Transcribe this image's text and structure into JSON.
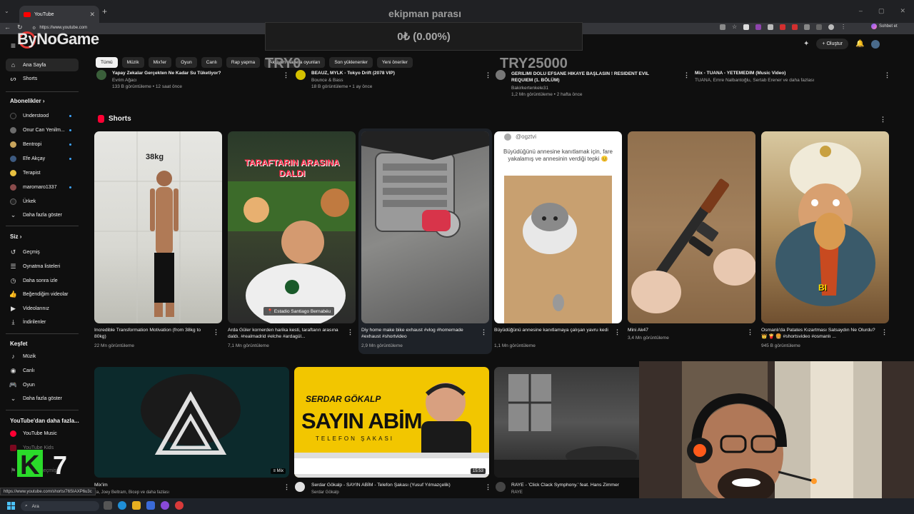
{
  "browser": {
    "tab_title": "YouTube",
    "url": "https://www.youtube.com",
    "chat_button": "Sohbet et",
    "status_url": "https://www.youtube.com/shorts/76SIAXP6u3c"
  },
  "donation": {
    "title": "ekipman parası",
    "progress_text": "0₺ (0.00%)",
    "progress": 0.0,
    "min_label": "TRY0",
    "max_label": "TRY25000"
  },
  "stream_logo": "ByNoGame",
  "header": {
    "create_label": "Oluştur"
  },
  "chips": [
    "Tümü",
    "Müzik",
    "Mix'ler",
    "Oyun",
    "Canlı",
    "Rap yapma",
    "Aksiyon macera oyunları",
    "Son yüklenenler",
    "Yeni öneriler"
  ],
  "sidebar": {
    "home": "Ana Sayfa",
    "shorts": "Shorts",
    "subs_head": "Abonelikler",
    "subs": [
      "Understood",
      "Onur Can Yenilm...",
      "Bentropi",
      "Efe Akçay",
      "Terapist",
      "maromaro1337",
      "Ürkek"
    ],
    "subs_more": "Daha fazla göster",
    "you_head": "Siz",
    "you_items": [
      "Geçmiş",
      "Oynatma listeleri",
      "Daha sonra izle",
      "Beğendiğim videolar",
      "Videolarınız",
      "İndirilenler"
    ],
    "explore_head": "Keşfet",
    "explore_items": [
      "Müzik",
      "Canlı",
      "Oyun"
    ],
    "explore_more": "Daha fazla göster",
    "more_head": "YouTube'dan daha fazla...",
    "more_items": [
      "YouTube Music",
      "YouTube Kids"
    ],
    "bottom_item": "Bildirim geçmişi"
  },
  "top_videos": [
    {
      "title": "Yapay Zekalar Gerçekten Ne Kadar Su Tüketiyor?",
      "channel": "Evrim Ağacı",
      "meta": "133 B görüntüleme • 12 saat önce"
    },
    {
      "title": "BEAUZ, MYLK - Tokyo Drift (2078 VIP)",
      "channel": "Bounce & Bass",
      "meta": "18 B görüntüleme • 1 ay önce"
    },
    {
      "title": "GERILIMI DOLU EFSANE HIKAYE BAŞLASIN ! RESIDENT EVIL REQUIEM (1. BÖLÜM)",
      "channel": "Bakirkertenkele31",
      "meta": "1,2 Mn görüntüleme • 2 hafta önce"
    },
    {
      "title": "Mix - TUANA - YETEMEDİM (Music Video)",
      "channel": "TUANA, Emre Nalbantoğlu, Sertab Erener ve daha fazlası",
      "meta": ""
    }
  ],
  "shorts_section": {
    "heading": "Shorts",
    "items": [
      {
        "title": "Incredible Transformation Motivation (from 38kg to 80kg)",
        "views": "22 Mn görüntüleme",
        "overlay": "38kg"
      },
      {
        "title": "Arda Güler kornerden harika kesti, taraftarın arasına daldı. #realmadrid #elche #ardagül...",
        "views": "7,1 Mn görüntüleme",
        "overlay": "TARAFTARIN ARASINA DALDI",
        "location": "Estadio Santiago Bernabéu"
      },
      {
        "title": "Diy home make bike exhaust #vlog #homemade #exhaust #shortvideo",
        "views": "2,9 Mn görüntüleme",
        "overlay": ""
      },
      {
        "title": "Büyüdüğünü annesine kanıtlamaya çalışan yavru kedi",
        "views": "1,1 Mn görüntüleme",
        "overlay": "Büyüdüğünü annesine kanıtlamak için, fare yakalamış ve annesinin verdiği tepki 😊",
        "handle": "@ogztvi"
      },
      {
        "title": "Mini Ak47",
        "views": "3,4 Mn görüntüleme",
        "overlay": ""
      },
      {
        "title": "Osmanlı'da Patates Kızartması Satsaydın Ne Olurdu? 👑 🍟 🍔 #shortsvideo #osmanlı ...",
        "views": "945 B görüntüleme",
        "overlay": "BI"
      }
    ]
  },
  "bottom_videos": [
    {
      "title": "Mix'im",
      "meta": "za, Joey Beltram, Bicep ve daha fazlası",
      "badge": "Mix"
    },
    {
      "title": "Serdar Gökalp - SAYIN ABİM - Telefon Şakası (Yusuf Yılmazçelik)",
      "meta": "Serdar Gökalp",
      "badge": "15:53",
      "thumb_top": "SERDAR GÖKALP",
      "thumb_main": "SAYIN ABİM",
      "thumb_sub": "TELEFON ŞAKASI"
    },
    {
      "title": "RAYE - 'Click Clack Symphony.' feat. Hans Zimmer",
      "meta": "RAYE",
      "badge": ""
    }
  ],
  "taskbar": {
    "search": "Ara"
  },
  "k7_text": "K 7",
  "colors": {
    "accent": "#ff0033",
    "bg": "#0f0f0f",
    "chip": "#272727"
  }
}
